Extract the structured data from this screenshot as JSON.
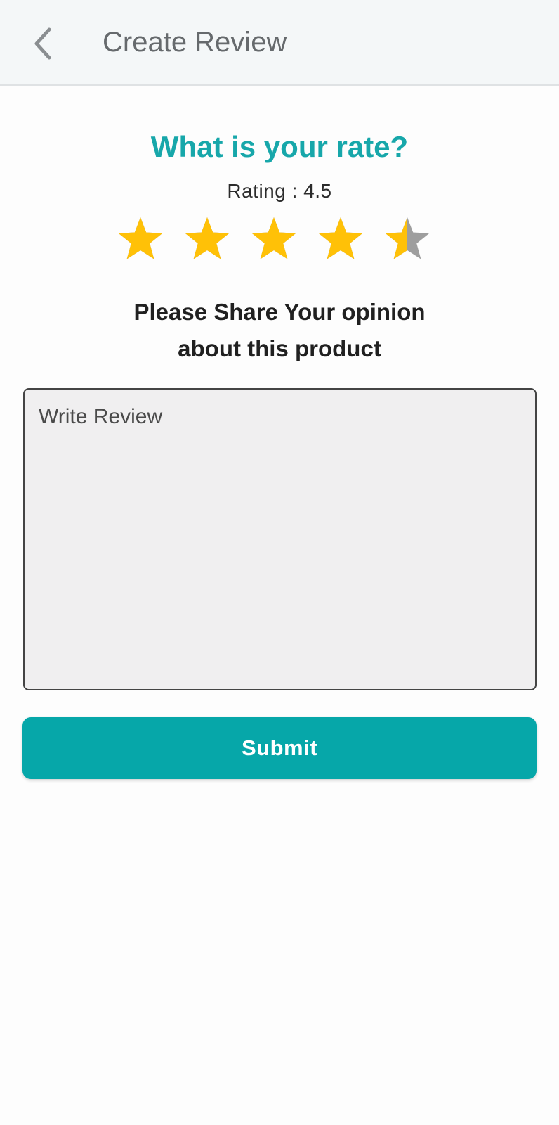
{
  "header": {
    "title": "Create Review",
    "back_icon": "chevron-left-icon"
  },
  "rating": {
    "question": "What is your rate?",
    "label": "Rating : 4.5",
    "value": 4.5,
    "max": 5,
    "star_icon": "star-icon",
    "filled_color": "#FFC107",
    "empty_color": "#9E9E9E"
  },
  "review": {
    "prompt_line1": "Please Share Your opinion",
    "prompt_line2": "about this product",
    "placeholder": "Write Review",
    "value": ""
  },
  "actions": {
    "submit_label": "Submit"
  },
  "colors": {
    "accent": "#06A7A9",
    "title_teal": "#17A7AA"
  }
}
